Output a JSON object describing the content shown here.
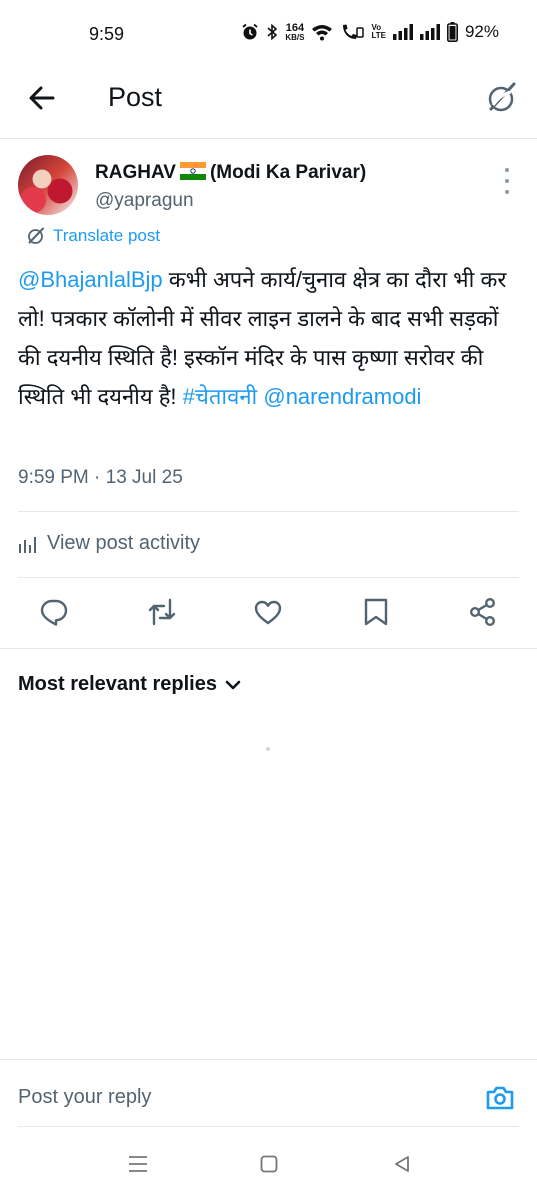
{
  "status_bar": {
    "time": "9:59",
    "net_speed_value": "164",
    "net_speed_unit": "KB/S",
    "volte_top": "Vo",
    "volte_bottom": "LTE",
    "battery_percent": "92%",
    "icons": [
      "alarm-icon",
      "bluetooth-icon",
      "wifi-icon",
      "wifi-calling-icon",
      "volte-icon",
      "signal-icon",
      "signal-icon",
      "battery-icon"
    ]
  },
  "header": {
    "title": "Post",
    "back_icon": "arrow-left-icon",
    "grok_icon": "grok-icon"
  },
  "post": {
    "author": {
      "name_part1": "RAGHAV",
      "name_part2": "(Modi Ka Parivar)",
      "flag": "india-flag-icon",
      "handle": "@yapragun"
    },
    "translate_label": "Translate post",
    "text": {
      "mention1": "@BhajanlalBjp",
      "body": " कभी अपने कार्य/चुनाव क्षेत्र का दौरा भी कर लो! पत्रकार कॉलोनी में सीवर लाइन डालने के बाद सभी सड़कों की दयनीय स्थिति है! इस्कॉन मंदिर के पास कृष्णा सरोवर की स्थिति भी दयनीय है! ",
      "hashtag": "#चेतावनी",
      "space": " ",
      "mention2": "@narendramodi"
    },
    "timestamp": "9:59 PM · 13 Jul 25",
    "activity_label": "View post activity",
    "actions": [
      "reply-icon",
      "repost-icon",
      "like-icon",
      "bookmark-icon",
      "share-icon"
    ]
  },
  "replies": {
    "sort_label": "Most relevant replies"
  },
  "reply_bar": {
    "placeholder": "Post your reply"
  },
  "colors": {
    "accent": "#1d9bf0",
    "text": "#0f1419",
    "muted": "#536471",
    "divider": "#e6e9ec"
  }
}
